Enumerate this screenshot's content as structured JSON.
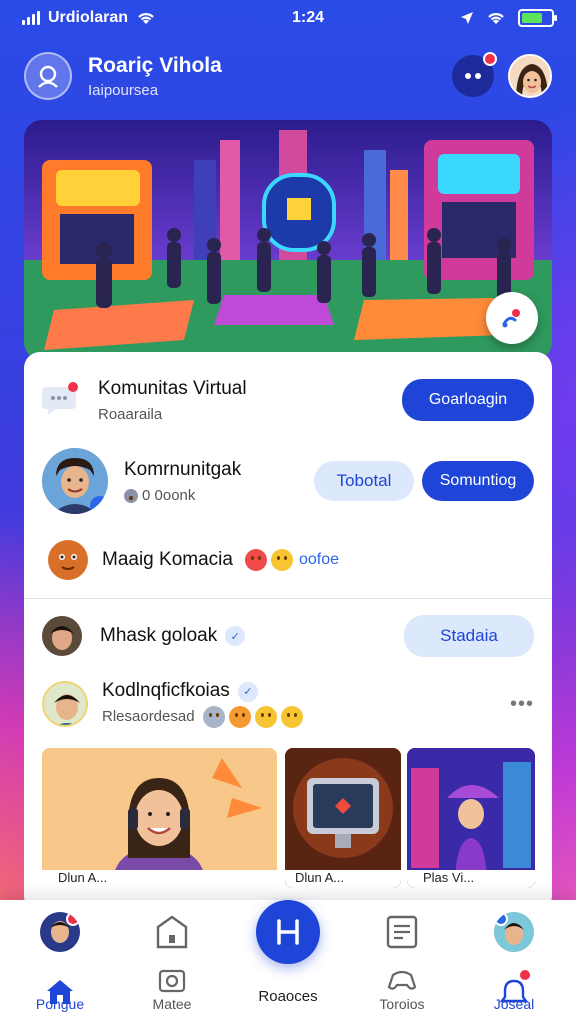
{
  "status_bar": {
    "carrier": "Urdiolaran",
    "time": "1:24"
  },
  "header": {
    "title": "Roariç Vihola",
    "subtitle": "Iaipoursea"
  },
  "colors": {
    "accent": "#1f45d8",
    "badge": "#f03048",
    "verified": "#2a66e8"
  },
  "icons": {
    "logo": "people-search-icon",
    "messages": "chat-dots-icon",
    "hero_fab": "sparkle-icon"
  },
  "section1": {
    "title": "Komunitas Virtual",
    "subtitle": "Roaaraila",
    "button": "Goarloagin"
  },
  "section2": {
    "title": "Komrnunitgak",
    "subtitle": "0 0oonk",
    "button_secondary": "Tobotal",
    "button_primary": "Somuntiog"
  },
  "section3": {
    "title": "Maaig Komacia",
    "reaction_text": "oofoe"
  },
  "feed": {
    "user1": {
      "name": "Mhask goloak",
      "button": "Stadaia"
    },
    "user2": {
      "name": "Kodlnqficfkoias",
      "subtitle": "Rlesaordesad"
    }
  },
  "thumbnails": [
    {
      "caption": "Dlun A..."
    },
    {
      "caption": "Dlun A..."
    },
    {
      "caption": "Plas Vi..."
    }
  ],
  "bottom_nav": {
    "items": [
      {
        "label": "Pongue",
        "active": true
      },
      {
        "label": "Matee",
        "active": false
      },
      {
        "label": "Roaoces",
        "active": false
      },
      {
        "label": "Toroios",
        "active": false
      },
      {
        "label": "Joseal",
        "active": false
      }
    ]
  }
}
